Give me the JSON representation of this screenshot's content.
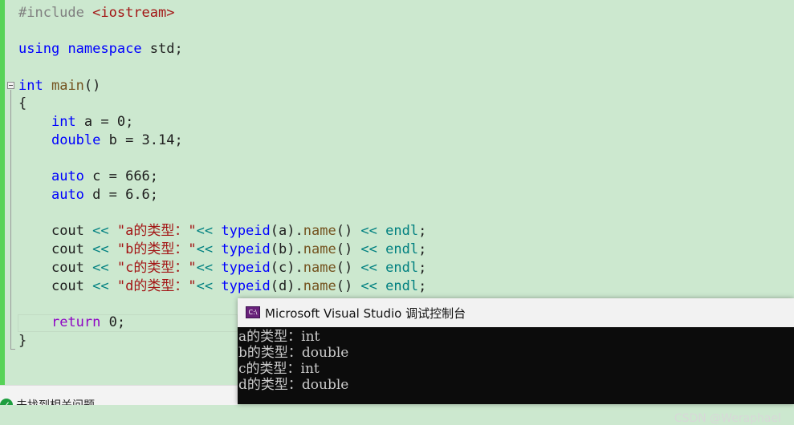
{
  "code": {
    "line_include": {
      "directive": "#include",
      "header": "<iostream>"
    },
    "line_using": {
      "kw1": "using",
      "kw2": "namespace",
      "rest": " std;"
    },
    "line_main": {
      "kw": "int",
      "fn": "main",
      "rest": "()"
    },
    "open_brace": "{",
    "line_a": {
      "kw": "int",
      "rest": " a = 0;"
    },
    "line_b": {
      "kw": "double",
      "rest": " b = 3.14;"
    },
    "line_c": {
      "kw": "auto",
      "rest": " c = 666;"
    },
    "line_d": {
      "kw": "auto",
      "rest": " d = 6.6;"
    },
    "cout_lines": [
      {
        "str": "\"a的类型：\"",
        "arg": "a"
      },
      {
        "str": "\"b的类型：\"",
        "arg": "b"
      },
      {
        "str": "\"c的类型：\"",
        "arg": "c"
      },
      {
        "str": "\"d的类型：\"",
        "arg": "d"
      }
    ],
    "tokens": {
      "cout": "cout",
      "shl": "<<",
      "typeid": "typeid",
      "name": "name",
      "endl": "endl"
    },
    "line_return": {
      "kw": "return",
      "rest": " 0;"
    },
    "close_brace": "}"
  },
  "statusbar": {
    "text": "未找到相关问题"
  },
  "console": {
    "title": "Microsoft Visual Studio 调试控制台",
    "icon_label": "C:\\",
    "output": [
      "a的类型：int",
      "b的类型：double",
      "c的类型：int",
      "d的类型：double"
    ]
  },
  "watermark": "CSDN @Weraphael",
  "icons": {
    "status": "check-circle-icon",
    "console": "console-app-icon"
  },
  "colors": {
    "editor_bg": "#cce8cf",
    "keyword": "#0000ff",
    "string": "#a31515",
    "change_bar": "#57d357"
  }
}
